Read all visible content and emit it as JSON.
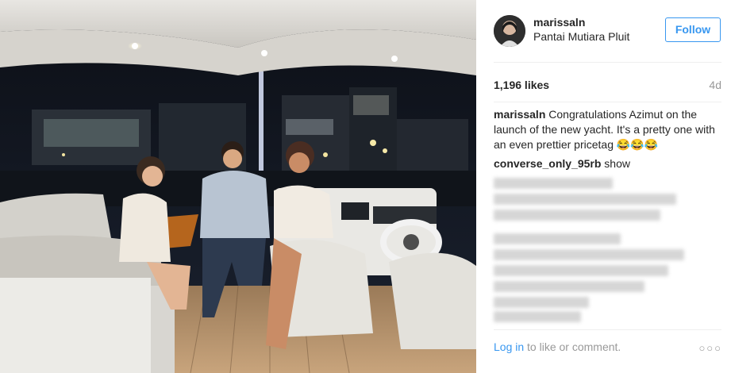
{
  "post": {
    "username": "marissaln",
    "location": "Pantai Mutiara Pluit",
    "follow_label": "Follow",
    "likes": "1,196 likes",
    "age": "4d",
    "caption_user": "marissaln",
    "caption_text": " Congratulations Azimut on the launch of the new yacht. It's a pretty one with an even prettier pricetag 😂😂😂",
    "comments": [
      {
        "user": "converse_only_95rb",
        "text": " show"
      }
    ],
    "login_link": "Log in",
    "login_text": " to like or comment.",
    "more_label": "○○○"
  },
  "icons": {
    "more": "more-options-icon"
  },
  "colors": {
    "accent": "#3897f0",
    "text": "#262626",
    "muted": "#999999",
    "divider": "#efefef"
  }
}
